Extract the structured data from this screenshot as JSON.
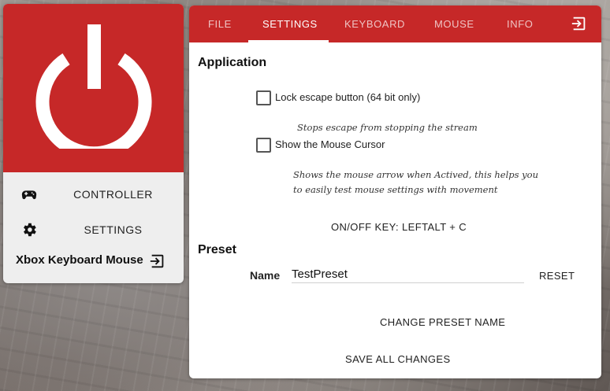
{
  "sidebar": {
    "items": [
      {
        "label": "CONTROLLER",
        "icon": "gamepad-icon"
      },
      {
        "label": "SETTINGS",
        "icon": "gear-icon"
      }
    ],
    "app_title": "Xbox Keyboard Mouse"
  },
  "tabs": [
    {
      "label": "FILE",
      "active": false
    },
    {
      "label": "SETTINGS",
      "active": true
    },
    {
      "label": "KEYBOARD",
      "active": false
    },
    {
      "label": "MOUSE",
      "active": false
    },
    {
      "label": "INFO",
      "active": false
    }
  ],
  "application": {
    "heading": "Application",
    "lock_escape": {
      "label": "Lock escape button (64 bit only)",
      "checked": false,
      "hint": "Stops escape from stopping the stream"
    },
    "show_cursor": {
      "label": "Show the Mouse Cursor",
      "checked": false,
      "hint_line1": "Shows the mouse arrow when Actived, this helps you",
      "hint_line2": "to easily test mouse settings with movement"
    },
    "onoff_key": "ON/OFF KEY: LEFTALT + C"
  },
  "preset": {
    "heading": "Preset",
    "name_label": "Name",
    "name_value": "TestPreset",
    "reset_label": "RESET",
    "change_name_label": "CHANGE PRESET NAME"
  },
  "save_all_label": "SAVE ALL CHANGES",
  "colors": {
    "accent": "#c62828",
    "panel": "#ffffff",
    "sidebar": "#eeeeee"
  }
}
